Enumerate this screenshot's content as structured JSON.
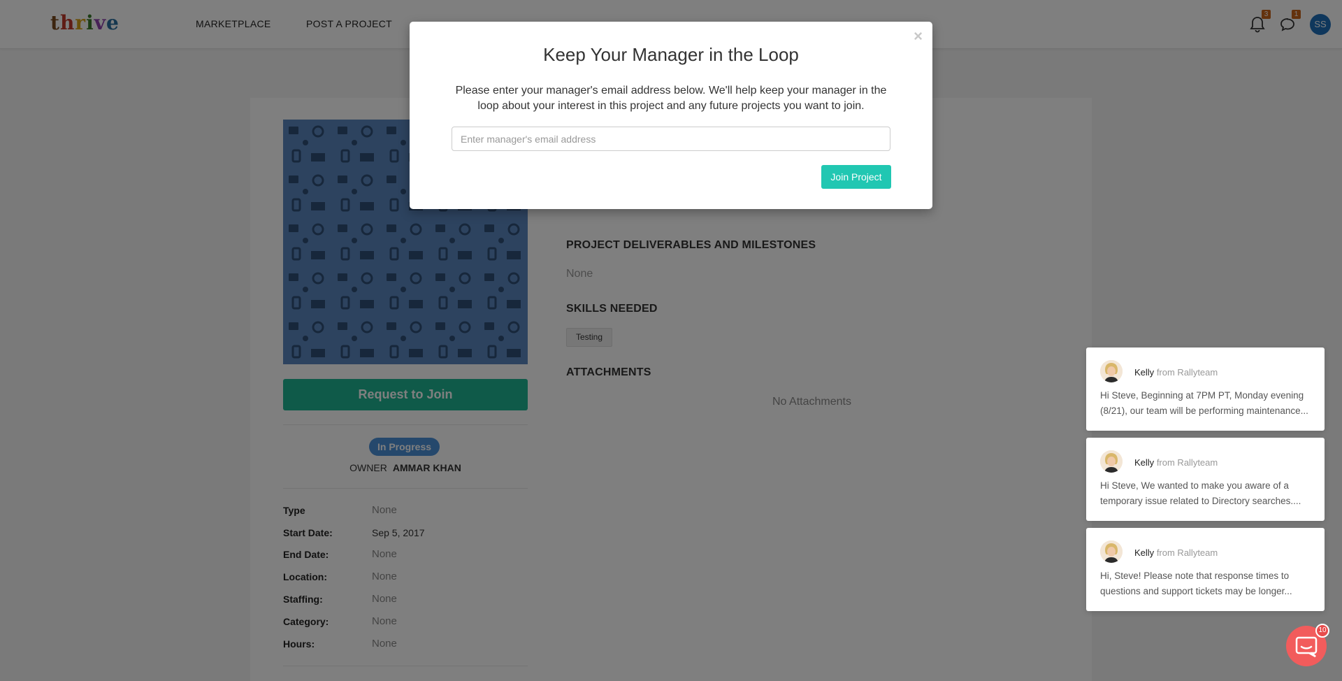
{
  "nav": {
    "logo_letters": [
      "t",
      "h",
      "r",
      "i",
      "v",
      "e"
    ],
    "links": [
      "MARKETPLACE",
      "POST A PROJECT"
    ],
    "notifications_count": "3",
    "messages_count": "1",
    "user_initials": "SS"
  },
  "project": {
    "request_button": "Request to Join",
    "status": "In Progress",
    "owner_label": "OWNER",
    "owner_name": "AMMAR KHAN",
    "meta": [
      {
        "label": "Type",
        "value": "None"
      },
      {
        "label": "Start Date:",
        "value": "Sep 5, 2017"
      },
      {
        "label": "End Date:",
        "value": "None"
      },
      {
        "label": "Location:",
        "value": "None"
      },
      {
        "label": "Staffing:",
        "value": "None"
      },
      {
        "label": "Category:",
        "value": "None"
      },
      {
        "label": "Hours:",
        "value": "None"
      }
    ],
    "deliverables_title": "PROJECT DELIVERABLES AND MILESTONES",
    "deliverables_value": "None",
    "skills_title": "SKILLS NEEDED",
    "skills": [
      "Testing"
    ],
    "attachments_title": "ATTACHMENTS",
    "attachments_value": "No Attachments"
  },
  "modal": {
    "close_glyph": "×",
    "title": "Keep Your Manager in the Loop",
    "description": "Please enter your manager's email address below. We'll help keep your manager in the loop about your interest in this project and any future projects you want to join.",
    "email_placeholder": "Enter manager's email address",
    "email_value": "",
    "submit_label": "Join Project"
  },
  "chat": {
    "messages": [
      {
        "sender": "Kelly",
        "from_text": "from Rallyteam",
        "text": "Hi Steve, Beginning at 7PM PT, Monday evening (8/21), our team will be performing maintenance..."
      },
      {
        "sender": "Kelly",
        "from_text": "from Rallyteam",
        "text": "Hi Steve, We wanted to make you aware of a temporary issue related to Directory searches...."
      },
      {
        "sender": "Kelly",
        "from_text": "from Rallyteam",
        "text": "Hi, Steve! Please note that response times to questions and support tickets may be longer..."
      }
    ],
    "launcher_badge": "10"
  },
  "colors": {
    "primary_green": "#1fb593",
    "modal_button": "#21c7b2",
    "status_blue": "#4a90d9",
    "badge_orange": "#c8641b",
    "chat_launcher": "#f25c5c"
  }
}
